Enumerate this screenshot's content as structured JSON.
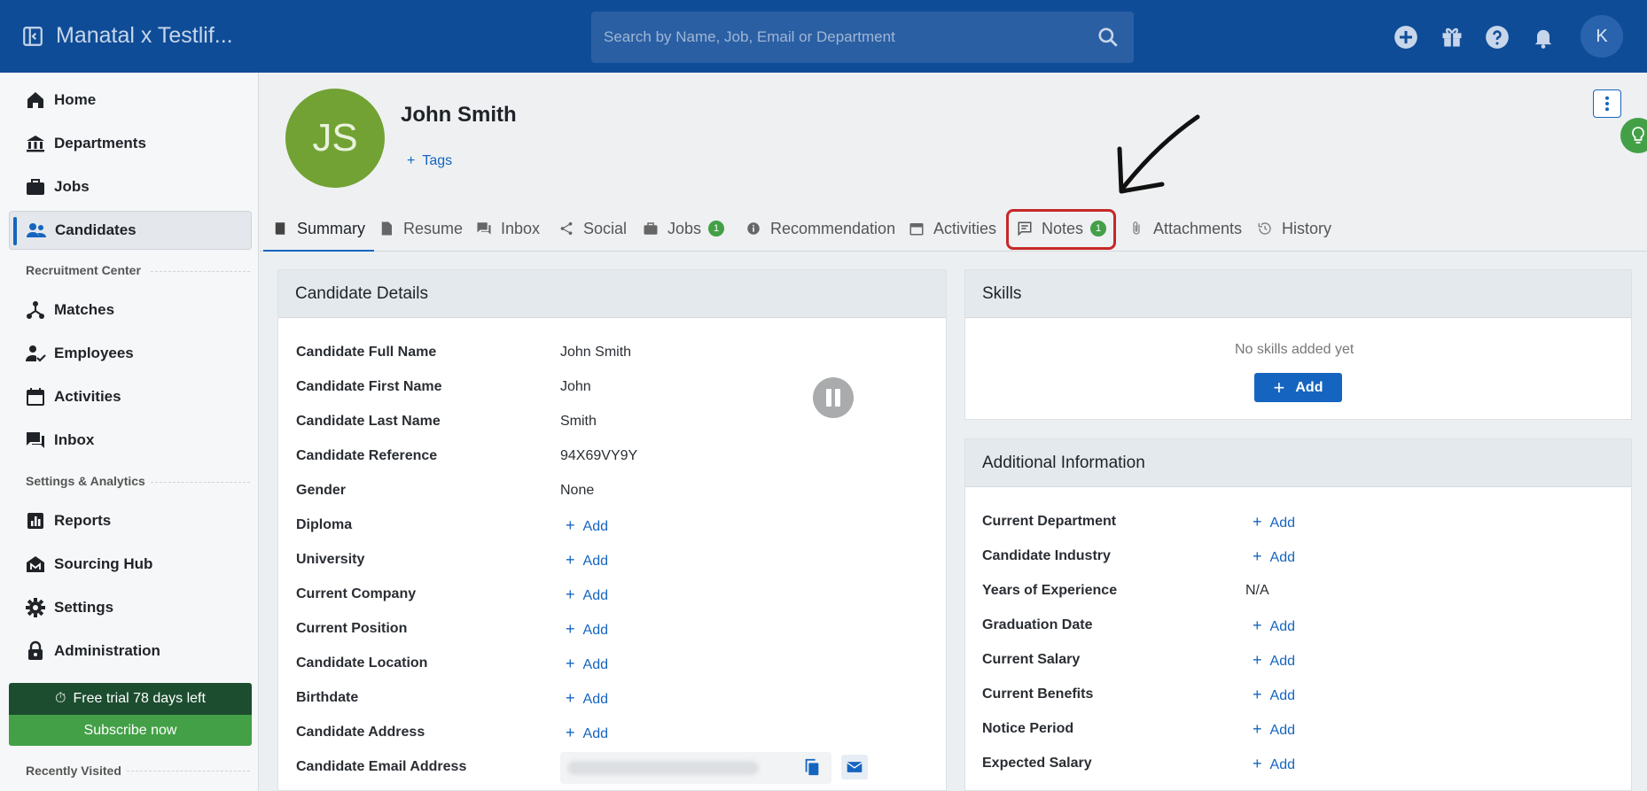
{
  "app": {
    "title": "Manatal x Testlif..."
  },
  "search": {
    "placeholder": "Search by Name, Job, Email or Department"
  },
  "topbar": {
    "avatar_initial": "K",
    "icons": [
      "add-circle-icon",
      "gift-icon",
      "help-icon",
      "bell-icon"
    ]
  },
  "sidebar": {
    "items": [
      {
        "label": "Home",
        "icon": "home-icon"
      },
      {
        "label": "Departments",
        "icon": "bank-icon"
      },
      {
        "label": "Jobs",
        "icon": "briefcase-icon"
      },
      {
        "label": "Candidates",
        "icon": "people-icon",
        "active": true
      },
      {
        "label": "Matches",
        "icon": "hub-icon"
      },
      {
        "label": "Employees",
        "icon": "person-check-icon"
      },
      {
        "label": "Activities",
        "icon": "calendar-icon"
      },
      {
        "label": "Inbox",
        "icon": "chat-icon"
      },
      {
        "label": "Reports",
        "icon": "bar-chart-icon"
      },
      {
        "label": "Sourcing Hub",
        "icon": "sourcing-hub-icon"
      },
      {
        "label": "Settings",
        "icon": "gear-icon"
      },
      {
        "label": "Administration",
        "icon": "lock-icon"
      }
    ],
    "sections": {
      "recruitment": "Recruitment Center",
      "settings": "Settings & Analytics",
      "recent": "Recently Visited"
    },
    "trial": "Free trial 78 days left",
    "subscribe": "Subscribe now"
  },
  "profile": {
    "initials": "JS",
    "name": "John Smith",
    "tags_label": "Tags",
    "avatar_color": "#71a233"
  },
  "tabs": [
    {
      "label": "Summary",
      "icon": "book-icon",
      "active": true
    },
    {
      "label": "Resume",
      "icon": "document-icon"
    },
    {
      "label": "Inbox",
      "icon": "chat-icon"
    },
    {
      "label": "Social",
      "icon": "share-icon"
    },
    {
      "label": "Jobs",
      "icon": "briefcase-icon",
      "badge": "1"
    },
    {
      "label": "Recommendation",
      "icon": "info-icon"
    },
    {
      "label": "Activities",
      "icon": "calendar-icon"
    },
    {
      "label": "Notes",
      "icon": "note-icon",
      "badge": "1",
      "highlighted": true
    },
    {
      "label": "Attachments",
      "icon": "paperclip-icon"
    },
    {
      "label": "History",
      "icon": "history-icon"
    }
  ],
  "candidate_details": {
    "title": "Candidate Details",
    "add_label": "Add",
    "rows": [
      {
        "label": "Candidate Full Name",
        "value": "John Smith"
      },
      {
        "label": "Candidate First Name",
        "value": "John"
      },
      {
        "label": "Candidate Last Name",
        "value": "Smith"
      },
      {
        "label": "Candidate Reference",
        "value": "94X69VY9Y"
      },
      {
        "label": "Gender",
        "value": "None"
      },
      {
        "label": "Diploma",
        "value": null
      },
      {
        "label": "University",
        "value": null
      },
      {
        "label": "Current Company",
        "value": null
      },
      {
        "label": "Current Position",
        "value": null
      },
      {
        "label": "Candidate Location",
        "value": null
      },
      {
        "label": "Birthdate",
        "value": null
      },
      {
        "label": "Candidate Address",
        "value": null
      },
      {
        "label": "Candidate Email Address",
        "value": null
      }
    ]
  },
  "skills": {
    "title": "Skills",
    "empty": "No skills added yet",
    "add_button": "Add"
  },
  "additional_info": {
    "title": "Additional Information",
    "add_label": "Add",
    "rows": [
      {
        "label": "Current Department",
        "value": null
      },
      {
        "label": "Candidate Industry",
        "value": null
      },
      {
        "label": "Years of Experience",
        "value": "N/A"
      },
      {
        "label": "Graduation Date",
        "value": null
      },
      {
        "label": "Current Salary",
        "value": null
      },
      {
        "label": "Current Benefits",
        "value": null
      },
      {
        "label": "Notice Period",
        "value": null
      },
      {
        "label": "Expected Salary",
        "value": null
      }
    ]
  },
  "colors": {
    "topbar": "#0f4c97",
    "accent": "#1565c0",
    "badge": "#43a047",
    "highlight": "#c62828"
  }
}
